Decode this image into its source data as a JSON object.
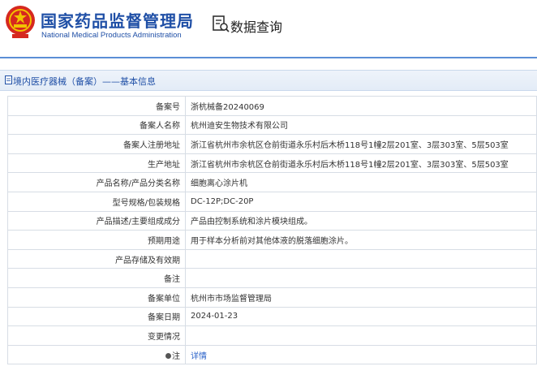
{
  "header": {
    "site_title_cn": "国家药品监督管理局",
    "site_title_en": "National Medical Products Administration",
    "query_title": "数据查询",
    "accent_color": "#1f4fa6"
  },
  "section": {
    "title": "境内医疗器械（备案）——基本信息"
  },
  "rows": [
    {
      "label": "备案号",
      "value": "浙杭械备20240069"
    },
    {
      "label": "备案人名称",
      "value": "杭州迪安生物技术有限公司"
    },
    {
      "label": "备案人注册地址",
      "value": "浙江省杭州市余杭区仓前街道永乐村后木桥118号1幢2层201室、3层303室、5层503室"
    },
    {
      "label": "生产地址",
      "value": "浙江省杭州市余杭区仓前街道永乐村后木桥118号1幢2层201室、3层303室、5层503室"
    },
    {
      "label": "产品名称/产品分类名称",
      "value": "细胞离心涂片机"
    },
    {
      "label": "型号规格/包装规格",
      "value": "DC-12P;DC-20P"
    },
    {
      "label": "产品描述/主要组成成分",
      "value": "产品由控制系统和涂片模块组成。"
    },
    {
      "label": "预期用途",
      "value": "用于样本分析前对其他体液的脱落细胞涂片。"
    },
    {
      "label": "产品存储及有效期",
      "value": ""
    },
    {
      "label": "备注",
      "value": ""
    },
    {
      "label": "备案单位",
      "value": "杭州市市场监督管理局"
    },
    {
      "label": "备案日期",
      "value": "2024-01-23"
    },
    {
      "label": "变更情况",
      "value": ""
    },
    {
      "label": "注",
      "value": "详情"
    }
  ]
}
